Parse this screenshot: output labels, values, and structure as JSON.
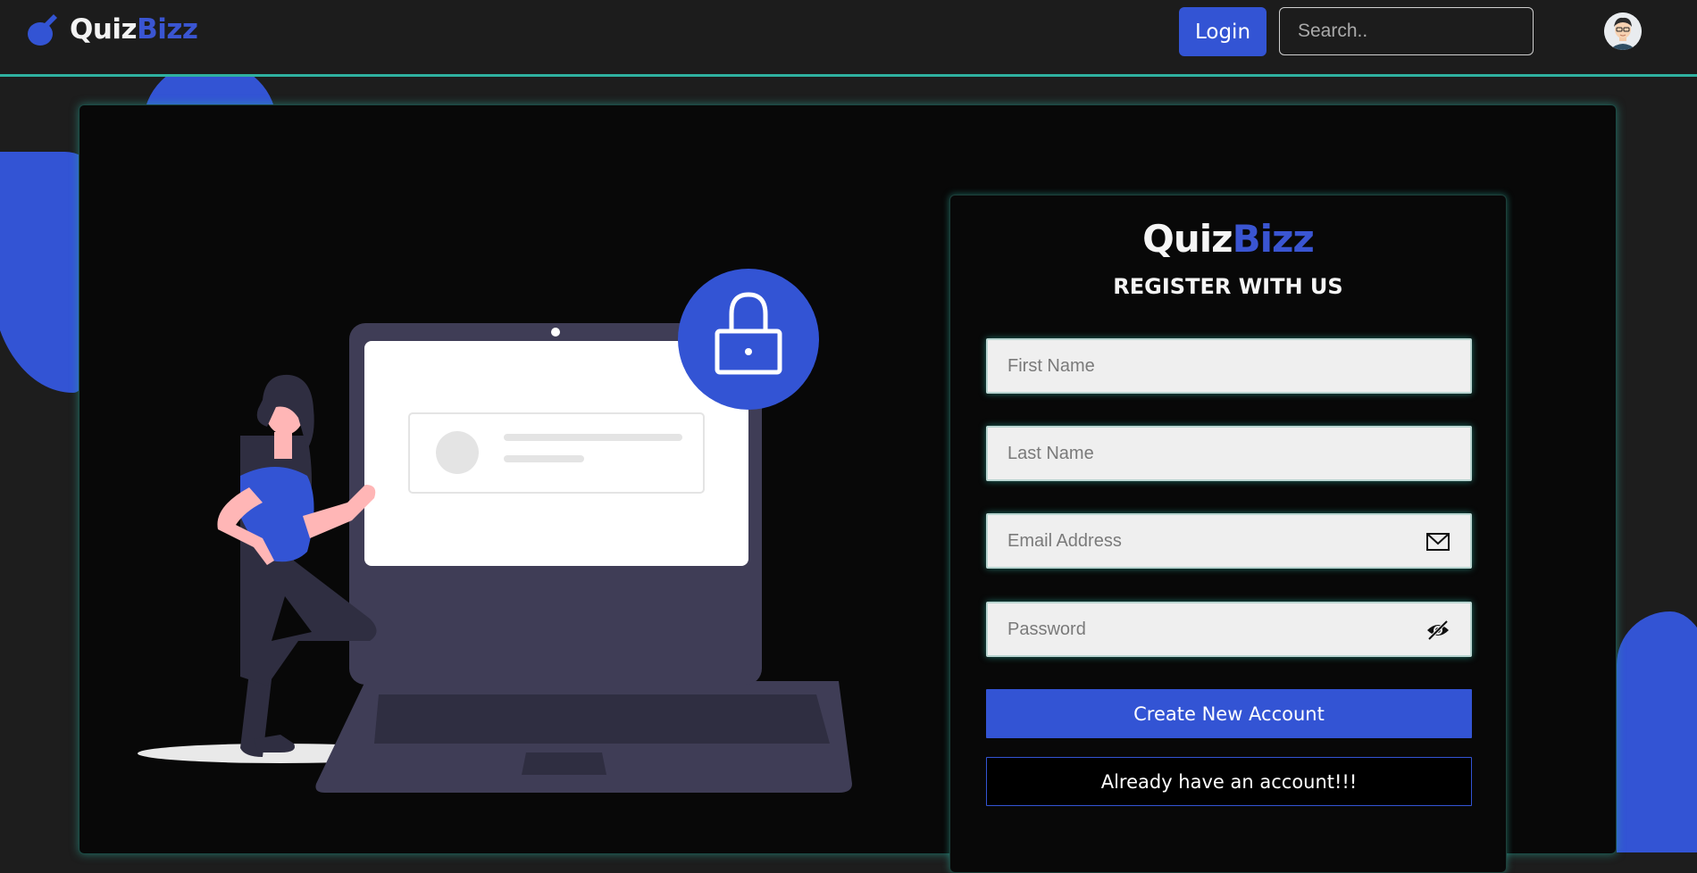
{
  "brand": {
    "part1": "Quiz",
    "part2": "Bizz"
  },
  "navbar": {
    "login_label": "Login",
    "search_placeholder": "Search.."
  },
  "form": {
    "heading": "REGISTER WITH US",
    "first_name_placeholder": "First Name",
    "last_name_placeholder": "Last Name",
    "email_placeholder": "Email Address",
    "password_placeholder": "Password",
    "create_account_label": "Create New Account",
    "have_account_label": "Already have an account!!!"
  },
  "icons": {
    "logo": "flask-icon",
    "email": "envelope-icon",
    "password": "eye-slash-icon",
    "illustration_lock": "lock-icon"
  },
  "colors": {
    "accent": "#3354d4",
    "glow": "#2fb1a0",
    "background": "#1d1d1d",
    "card": "#080808"
  }
}
